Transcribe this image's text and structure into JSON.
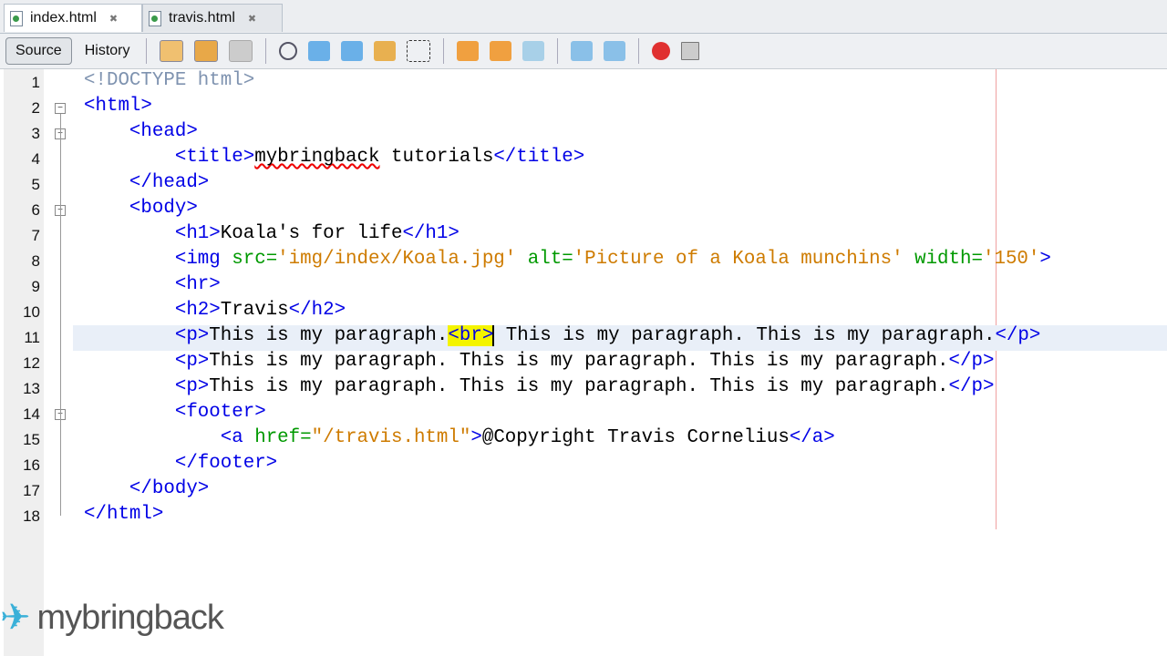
{
  "tabs": [
    {
      "label": "index.html",
      "active": true
    },
    {
      "label": "travis.html",
      "active": false
    }
  ],
  "toolbar": {
    "source": "Source",
    "history": "History"
  },
  "code": [
    [
      [
        "d",
        "<!DOCTYPE html>"
      ]
    ],
    [
      [
        "t",
        "<html>"
      ]
    ],
    [
      [
        "x2",
        "    "
      ],
      [
        "t",
        "<head>"
      ]
    ],
    [
      [
        "x2",
        "        "
      ],
      [
        "t",
        "<title>"
      ],
      [
        "sq",
        "mybringback"
      ],
      [
        "x2",
        " tutorials"
      ],
      [
        "t",
        "</title>"
      ]
    ],
    [
      [
        "x2",
        "    "
      ],
      [
        "t",
        "</head>"
      ]
    ],
    [
      [
        "x2",
        "    "
      ],
      [
        "t",
        "<body>"
      ]
    ],
    [
      [
        "x2",
        "        "
      ],
      [
        "t",
        "<h1>"
      ],
      [
        "x2",
        "Koala's for life"
      ],
      [
        "t",
        "</h1>"
      ]
    ],
    [
      [
        "x2",
        "        "
      ],
      [
        "t",
        "<img "
      ],
      [
        "a",
        "src="
      ],
      [
        "v",
        "'img/index/Koala.jpg'"
      ],
      [
        "x2",
        " "
      ],
      [
        "a",
        "alt="
      ],
      [
        "v",
        "'Picture of a Koala munchins'"
      ],
      [
        "x2",
        " "
      ],
      [
        "a",
        "width="
      ],
      [
        "v",
        "'150'"
      ],
      [
        "t",
        ">"
      ]
    ],
    [
      [
        "x2",
        "        "
      ],
      [
        "t",
        "<hr>"
      ]
    ],
    [
      [
        "x2",
        "        "
      ],
      [
        "t",
        "<h2>"
      ],
      [
        "x2",
        "Travis"
      ],
      [
        "t",
        "</h2>"
      ]
    ],
    [
      [
        "x2",
        "        "
      ],
      [
        "t",
        "<p>"
      ],
      [
        "x2",
        "This is my paragraph."
      ],
      [
        "hl",
        "<br>"
      ],
      [
        "x2",
        " This is my paragraph. This is my paragraph."
      ],
      [
        "t",
        "</p>"
      ]
    ],
    [
      [
        "x2",
        "        "
      ],
      [
        "t",
        "<p>"
      ],
      [
        "x2",
        "This is my paragraph. This is my paragraph. This is my paragraph."
      ],
      [
        "t",
        "</p>"
      ]
    ],
    [
      [
        "x2",
        "        "
      ],
      [
        "t",
        "<p>"
      ],
      [
        "x2",
        "This is my paragraph. This is my paragraph. This is my paragraph."
      ],
      [
        "t",
        "</p>"
      ]
    ],
    [
      [
        "x2",
        "        "
      ],
      [
        "t",
        "<footer>"
      ]
    ],
    [
      [
        "x2",
        "            "
      ],
      [
        "t",
        "<a "
      ],
      [
        "a",
        "href="
      ],
      [
        "v",
        "\"/travis.html\""
      ],
      [
        "t",
        ">"
      ],
      [
        "x2",
        "@Copyright Travis Cornelius"
      ],
      [
        "t",
        "</a>"
      ]
    ],
    [
      [
        "x2",
        "        "
      ],
      [
        "t",
        "</footer>"
      ]
    ],
    [
      [
        "x2",
        "    "
      ],
      [
        "t",
        "</body>"
      ]
    ],
    [
      [
        "t",
        "</html>"
      ]
    ]
  ],
  "current_line": 11,
  "fold_lines": [
    2,
    3,
    6,
    14
  ],
  "logo": "mybringback"
}
